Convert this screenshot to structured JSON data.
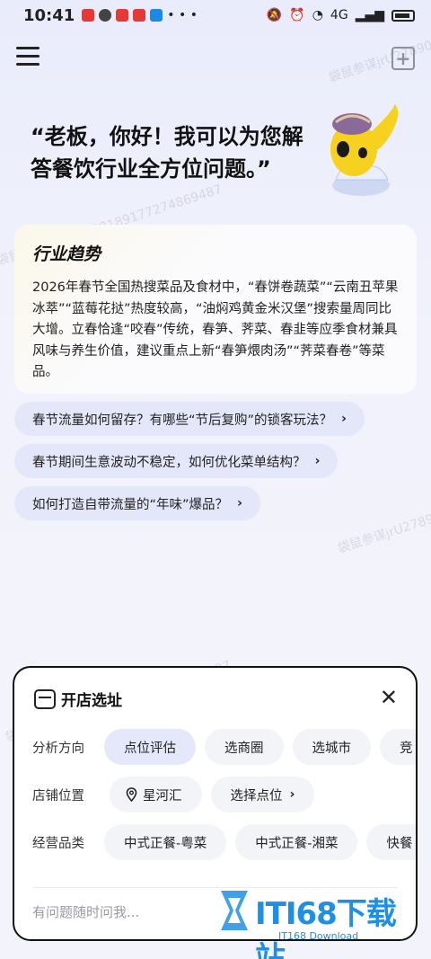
{
  "status": {
    "time": "10:41",
    "network": "4G"
  },
  "greeting": "“老板，你好！我可以为您解答餐饮行业全方位问题。”",
  "trend": {
    "title": "行业趋势",
    "body": "2026年春节全国热搜菜品及食材中，“春饼卷蔬菜”“云南丑苹果冰萃”“蓝莓花挞”热度较高，“油焖鸡黄金米汉堡”搜索量周同比大增。立春恰逢“咬春”传统，春笋、荠菜、春韭等应季食材兼具风味与养生价值，建议重点上新“春笋煨肉汤”“荠菜春卷”等菜品。"
  },
  "suggestions": [
    {
      "text": "春节流量如何留存？有哪些“节后复购”的锁客玩法？"
    },
    {
      "text": "春节期间生意波动不稳定，如何优化菜单结构？"
    },
    {
      "text": "如何打造自带流量的“年味”爆品？"
    }
  ],
  "watermark": "袋鼠参谋jrU278900189177274869487",
  "panel": {
    "title": "开店选址",
    "rows": [
      {
        "label": "分析方向",
        "chips": [
          "点位评估",
          "选商圈",
          "选城市",
          "竞"
        ]
      },
      {
        "label": "店铺位置",
        "chips": [
          "星河汇",
          "选择点位"
        ]
      },
      {
        "label": "经营品类",
        "chips": [
          "中式正餐-粤菜",
          "中式正餐-湘菜",
          "快餐"
        ]
      }
    ],
    "input_placeholder": "有问题随时问我..."
  },
  "logo": {
    "main": "ITI68下载站",
    "sub": "IT168 Download"
  }
}
